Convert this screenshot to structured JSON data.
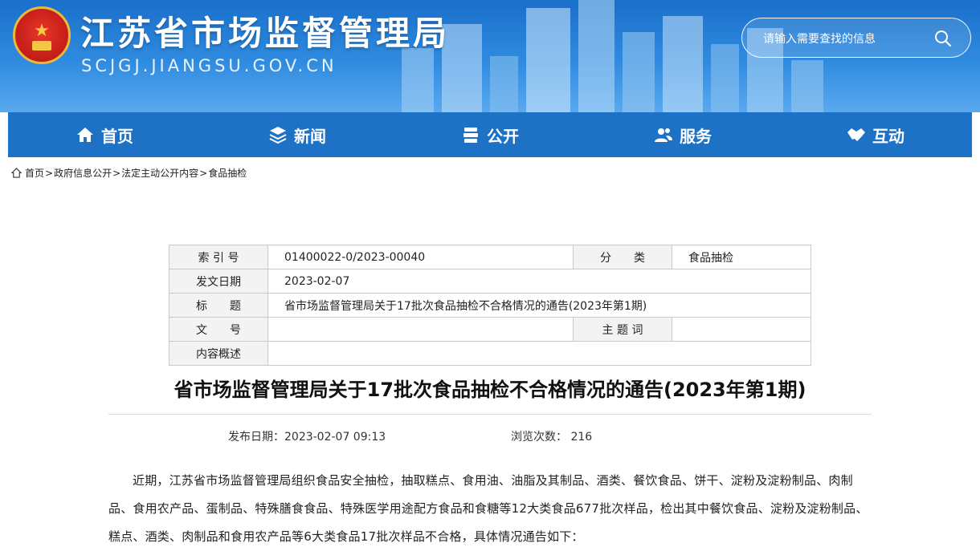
{
  "header": {
    "site_title": "江苏省市场监督管理局",
    "site_domain": "SCJGJ.JIANGSU.GOV.CN",
    "search_placeholder": "请输入需要查找的信息"
  },
  "nav": {
    "items": [
      {
        "label": "首页",
        "icon": "home-icon"
      },
      {
        "label": "新闻",
        "icon": "layers-icon"
      },
      {
        "label": "公开",
        "icon": "stack-icon"
      },
      {
        "label": "服务",
        "icon": "users-icon"
      },
      {
        "label": "互动",
        "icon": "handshake-icon"
      }
    ]
  },
  "breadcrumb": {
    "items": [
      "首页",
      "政府信息公开",
      "法定主动公开内容",
      "食品抽检"
    ],
    "separator": ">"
  },
  "meta": {
    "index_label": "索 引 号",
    "index_value": "01400022-0/2023-00040",
    "category_label": "分　　类",
    "category_value": "食品抽检",
    "date_label": "发文日期",
    "date_value": "2023-02-07",
    "title_label": "标　　题",
    "title_value": "省市场监督管理局关于17批次食品抽检不合格情况的通告(2023年第1期)",
    "doc_no_label": "文　　号",
    "doc_no_value": "",
    "subject_label": "主 题 词",
    "subject_value": "",
    "summary_label": "内容概述",
    "summary_value": ""
  },
  "article": {
    "title": "省市场监督管理局关于17批次食品抽检不合格情况的通告(2023年第1期)",
    "publish_label": "发布日期：",
    "publish_value": "2023-02-07 09:13",
    "views_label": "浏览次数：",
    "views_value": "216",
    "paragraph": "近期，江苏省市场监督管理局组织食品安全抽检，抽取糕点、食用油、油脂及其制品、酒类、餐饮食品、饼干、淀粉及淀粉制品、肉制品、食用农产品、蛋制品、特殊膳食食品、特殊医学用途配方食品和食糖等12大类食品677批次样品，检出其中餐饮食品、淀粉及淀粉制品、糕点、酒类、肉制品和食用农产品等6大类食品17批次样品不合格，具体情况通告如下："
  },
  "colors": {
    "header_blue": "#2f8be0",
    "nav_blue": "#1e72c6",
    "table_key_bg": "#f3f3f3"
  }
}
